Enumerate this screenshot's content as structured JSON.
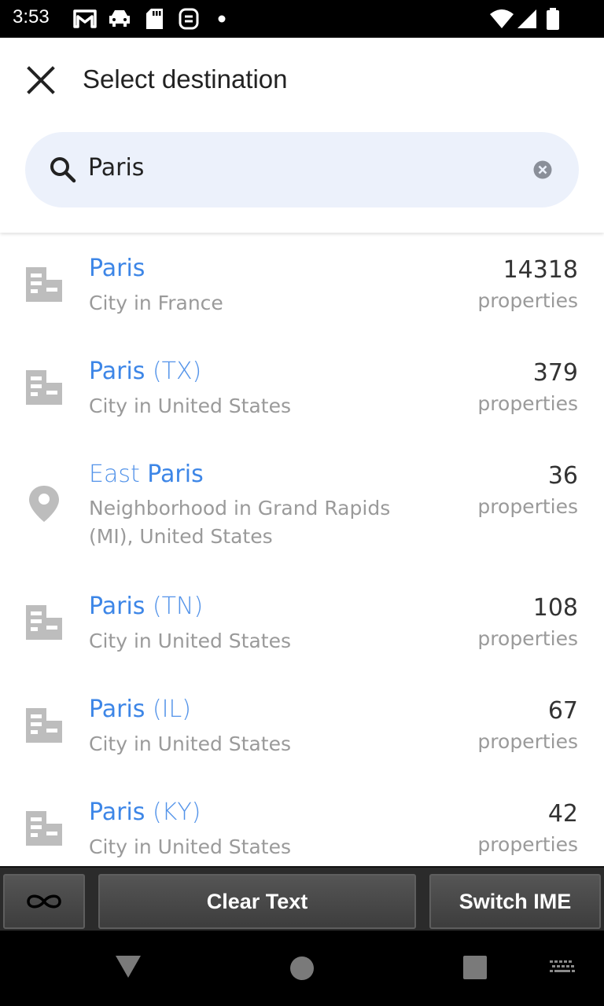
{
  "status_bar": {
    "time": "3:53",
    "left_icons": [
      "gmail-icon",
      "car-icon",
      "sd-card-icon",
      "sync-icon",
      "dot-icon"
    ],
    "right_icons": [
      "wifi-icon",
      "signal-icon",
      "battery-icon"
    ]
  },
  "header": {
    "title": "Select destination",
    "close_icon": "close-icon"
  },
  "search": {
    "value": "Paris",
    "placeholder": "",
    "search_icon": "search-icon",
    "clear_icon": "clear-circle-icon"
  },
  "results": [
    {
      "name_prefix": "",
      "name_main": "Paris",
      "name_suffix": "",
      "subtitle": "City in France",
      "count": "14318",
      "count_label": "properties",
      "icon": "building-icon"
    },
    {
      "name_prefix": "",
      "name_main": "Paris",
      "name_suffix": " (TX)",
      "subtitle": "City in United States",
      "count": "379",
      "count_label": "properties",
      "icon": "building-icon"
    },
    {
      "name_prefix": "East ",
      "name_main": "Paris",
      "name_suffix": "",
      "subtitle": "Neighborhood in Grand Rapids (MI), United States",
      "count": "36",
      "count_label": "properties",
      "icon": "location-pin-icon"
    },
    {
      "name_prefix": "",
      "name_main": "Paris",
      "name_suffix": " (TN)",
      "subtitle": "City in United States",
      "count": "108",
      "count_label": "properties",
      "icon": "building-icon"
    },
    {
      "name_prefix": "",
      "name_main": "Paris",
      "name_suffix": " (IL)",
      "subtitle": "City in United States",
      "count": "67",
      "count_label": "properties",
      "icon": "building-icon"
    },
    {
      "name_prefix": "",
      "name_main": "Paris",
      "name_suffix": " (KY)",
      "subtitle": "City in United States",
      "count": "42",
      "count_label": "properties",
      "icon": "building-icon"
    }
  ],
  "ime_bar": {
    "infinity_icon": "infinity-icon",
    "clear_text": "Clear Text",
    "switch_ime": "Switch IME"
  },
  "nav_bar": {
    "back_icon": "back-triangle-icon",
    "home_icon": "home-circle-icon",
    "recents_icon": "recents-square-icon",
    "keyboard_icon": "keyboard-icon"
  },
  "colors": {
    "link_blue": "#3d86e7",
    "search_bg": "#ecf1fb",
    "subtitle_gray": "#9a9a9a",
    "icon_gray": "#bdbdbd"
  }
}
